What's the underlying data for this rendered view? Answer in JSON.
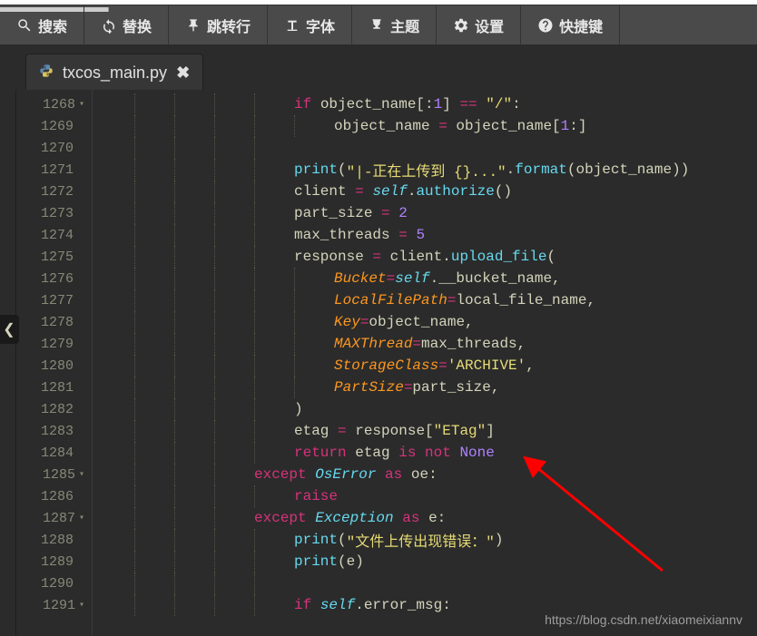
{
  "toolbar": [
    {
      "icon": "search",
      "label": "搜索"
    },
    {
      "icon": "replace",
      "label": "替换"
    },
    {
      "icon": "pin",
      "label": "跳转行"
    },
    {
      "icon": "font",
      "label": "字体"
    },
    {
      "icon": "theme",
      "label": "主题"
    },
    {
      "icon": "gear",
      "label": "设置"
    },
    {
      "icon": "help",
      "label": "快捷键"
    }
  ],
  "tab": {
    "filename": "txcos_main.py"
  },
  "gutter_start": 1268,
  "gutter_end": 1291,
  "fold_lines": [
    1268,
    1285,
    1287,
    1291
  ],
  "code_lines": [
    [
      {
        "indent": 5
      },
      {
        "t": "if ",
        "c": "tok-kw"
      },
      {
        "t": "object_name[",
        "c": "tok-def"
      },
      {
        "t": ":",
        "c": "tok-def"
      },
      {
        "t": "1",
        "c": "tok-num"
      },
      {
        "t": "] ",
        "c": "tok-def"
      },
      {
        "t": "==",
        "c": "tok-op"
      },
      {
        "t": " ",
        "c": "tok-def"
      },
      {
        "t": "\"/\"",
        "c": "tok-str"
      },
      {
        "t": ":",
        "c": "tok-def"
      }
    ],
    [
      {
        "indent": 6
      },
      {
        "t": "object_name ",
        "c": "tok-def"
      },
      {
        "t": "=",
        "c": "tok-op"
      },
      {
        "t": " object_name[",
        "c": "tok-def"
      },
      {
        "t": "1",
        "c": "tok-num"
      },
      {
        "t": ":]",
        "c": "tok-def"
      }
    ],
    [
      {
        "indent": 5
      }
    ],
    [
      {
        "indent": 5
      },
      {
        "t": "print",
        "c": "tok-fn-call"
      },
      {
        "t": "(",
        "c": "tok-def"
      },
      {
        "t": "\"|-正在上传到 {}...\"",
        "c": "tok-str"
      },
      {
        "t": ".",
        "c": "tok-def"
      },
      {
        "t": "format",
        "c": "tok-fn-call"
      },
      {
        "t": "(object_name))",
        "c": "tok-def"
      }
    ],
    [
      {
        "indent": 5
      },
      {
        "t": "client ",
        "c": "tok-def"
      },
      {
        "t": "=",
        "c": "tok-op"
      },
      {
        "t": " ",
        "c": "tok-def"
      },
      {
        "t": "self",
        "c": "tok-lang"
      },
      {
        "t": ".",
        "c": "tok-def"
      },
      {
        "t": "authorize",
        "c": "tok-fn-call"
      },
      {
        "t": "()",
        "c": "tok-def"
      }
    ],
    [
      {
        "indent": 5
      },
      {
        "t": "part_size ",
        "c": "tok-def"
      },
      {
        "t": "=",
        "c": "tok-op"
      },
      {
        "t": " ",
        "c": "tok-def"
      },
      {
        "t": "2",
        "c": "tok-num"
      }
    ],
    [
      {
        "indent": 5
      },
      {
        "t": "max_threads ",
        "c": "tok-def"
      },
      {
        "t": "=",
        "c": "tok-op"
      },
      {
        "t": " ",
        "c": "tok-def"
      },
      {
        "t": "5",
        "c": "tok-num"
      }
    ],
    [
      {
        "indent": 5
      },
      {
        "t": "response ",
        "c": "tok-def"
      },
      {
        "t": "=",
        "c": "tok-op"
      },
      {
        "t": " client.",
        "c": "tok-def"
      },
      {
        "t": "upload_file",
        "c": "tok-fn-call"
      },
      {
        "t": "(",
        "c": "tok-def"
      }
    ],
    [
      {
        "indent": 6
      },
      {
        "t": "Bucket",
        "c": "tok-arg"
      },
      {
        "t": "=",
        "c": "tok-op"
      },
      {
        "t": "self",
        "c": "tok-lang"
      },
      {
        "t": ".__bucket_name,",
        "c": "tok-def"
      }
    ],
    [
      {
        "indent": 6
      },
      {
        "t": "LocalFilePath",
        "c": "tok-arg"
      },
      {
        "t": "=",
        "c": "tok-op"
      },
      {
        "t": "local_file_name,",
        "c": "tok-def"
      }
    ],
    [
      {
        "indent": 6
      },
      {
        "t": "Key",
        "c": "tok-arg"
      },
      {
        "t": "=",
        "c": "tok-op"
      },
      {
        "t": "object_name,",
        "c": "tok-def"
      }
    ],
    [
      {
        "indent": 6
      },
      {
        "t": "MAXThread",
        "c": "tok-arg"
      },
      {
        "t": "=",
        "c": "tok-op"
      },
      {
        "t": "max_threads,",
        "c": "tok-def"
      }
    ],
    [
      {
        "indent": 6
      },
      {
        "t": "StorageClass",
        "c": "tok-arg"
      },
      {
        "t": "=",
        "c": "tok-op"
      },
      {
        "t": "'ARCHIVE'",
        "c": "tok-str"
      },
      {
        "t": ",",
        "c": "tok-def"
      }
    ],
    [
      {
        "indent": 6
      },
      {
        "t": "PartSize",
        "c": "tok-arg"
      },
      {
        "t": "=",
        "c": "tok-op"
      },
      {
        "t": "part_size,",
        "c": "tok-def"
      }
    ],
    [
      {
        "indent": 5
      },
      {
        "t": ")",
        "c": "tok-def"
      }
    ],
    [
      {
        "indent": 5
      },
      {
        "t": "etag ",
        "c": "tok-def"
      },
      {
        "t": "=",
        "c": "tok-op"
      },
      {
        "t": " response[",
        "c": "tok-def"
      },
      {
        "t": "\"ETag\"",
        "c": "tok-str"
      },
      {
        "t": "]",
        "c": "tok-def"
      }
    ],
    [
      {
        "indent": 5
      },
      {
        "t": "return ",
        "c": "tok-kw"
      },
      {
        "t": "etag ",
        "c": "tok-def"
      },
      {
        "t": "is not ",
        "c": "tok-kw"
      },
      {
        "t": "None",
        "c": "tok-num"
      }
    ],
    [
      {
        "indent": 4
      },
      {
        "t": "except ",
        "c": "tok-kw"
      },
      {
        "t": "OsError",
        "c": "tok-fn"
      },
      {
        "t": " ",
        "c": "tok-def"
      },
      {
        "t": "as ",
        "c": "tok-kw"
      },
      {
        "t": "oe:",
        "c": "tok-def"
      }
    ],
    [
      {
        "indent": 5
      },
      {
        "t": "raise",
        "c": "tok-kw"
      }
    ],
    [
      {
        "indent": 4
      },
      {
        "t": "except ",
        "c": "tok-kw"
      },
      {
        "t": "Exception",
        "c": "tok-fn"
      },
      {
        "t": " ",
        "c": "tok-def"
      },
      {
        "t": "as ",
        "c": "tok-kw"
      },
      {
        "t": "e:",
        "c": "tok-def"
      }
    ],
    [
      {
        "indent": 5
      },
      {
        "t": "print",
        "c": "tok-fn-call"
      },
      {
        "t": "(",
        "c": "tok-def"
      },
      {
        "t": "\"文件上传出现错误：\"",
        "c": "tok-str"
      },
      {
        "t": ")",
        "c": "tok-def"
      }
    ],
    [
      {
        "indent": 5
      },
      {
        "t": "print",
        "c": "tok-fn-call"
      },
      {
        "t": "(e)",
        "c": "tok-def"
      }
    ],
    [
      {
        "indent": 5
      }
    ],
    [
      {
        "indent": 5
      },
      {
        "t": "if ",
        "c": "tok-kw"
      },
      {
        "t": "self",
        "c": "tok-lang"
      },
      {
        "t": ".error_msg:",
        "c": "tok-def"
      }
    ]
  ],
  "watermark": "https://blog.csdn.net/xiaomeixiannv"
}
